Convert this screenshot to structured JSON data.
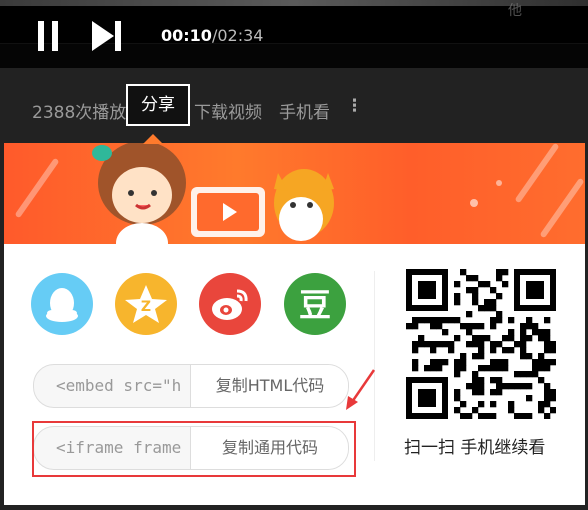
{
  "player": {
    "time_current": "00:10",
    "time_separator": "/",
    "time_total": "02:34",
    "corner_text": "他"
  },
  "toolbar": {
    "plays": "2388次播放",
    "share": "分享",
    "download": "下载视频",
    "mobile": "手机看",
    "more": "⋮"
  },
  "share_panel": {
    "social": [
      {
        "name": "qq",
        "color": "#66ccf5"
      },
      {
        "name": "qzone",
        "color": "#f7b52d"
      },
      {
        "name": "weibo",
        "color": "#e9463c"
      },
      {
        "name": "douban",
        "color": "#3ca13f",
        "glyph": "豆"
      }
    ],
    "embed_html": {
      "code": "<embed src=\"htt",
      "copy_label": "复制HTML代码"
    },
    "embed_iframe": {
      "code": "<iframe frameborder",
      "copy_label": "复制通用代码"
    },
    "qr_label": "扫一扫 手机继续看"
  },
  "colors": {
    "banner": "#ff6a2d",
    "highlight": "#e8393a",
    "qq": "#66ccf5",
    "qzone": "#f7b52d",
    "weibo": "#e9463c",
    "douban": "#3ca13f"
  }
}
